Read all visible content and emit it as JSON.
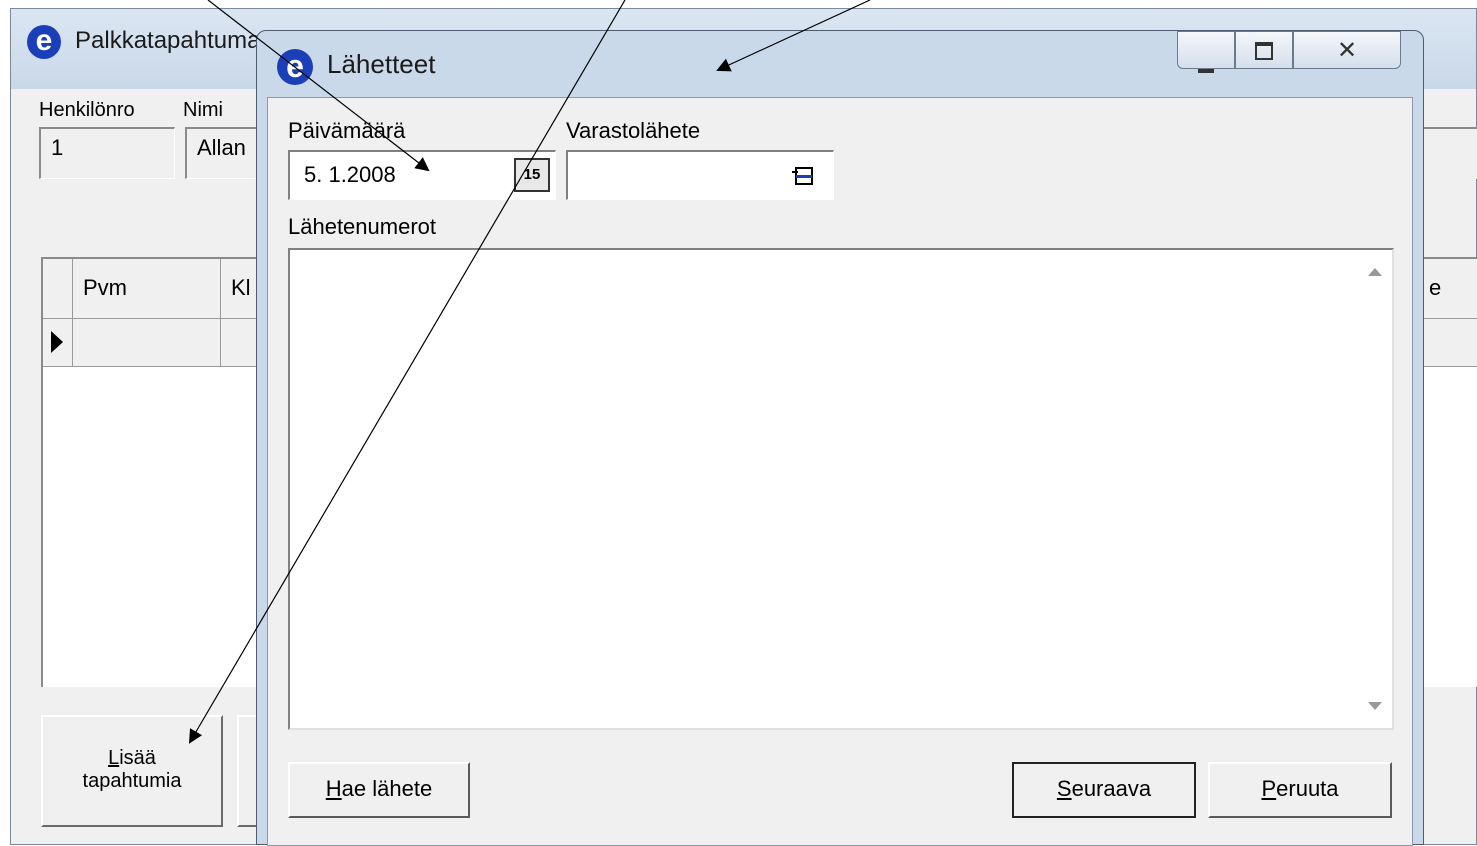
{
  "background_window": {
    "title": "Palkkatapahtumat",
    "henkilonro_label": "Henkilönro",
    "nimi_label": "Nimi",
    "henkilonro_value": "1",
    "nimi_value": "Allan",
    "grid": {
      "columns": [
        "Pvm",
        "Kl",
        "e"
      ]
    },
    "add_button_label_line1": "Lisää",
    "add_button_label_line2": "tapahtumia",
    "add_button_mnemonic": "L"
  },
  "dialog": {
    "title": "Lähetteet",
    "date_label": "Päivämäärä",
    "date_value": "5. 1.2008",
    "calendar_icon_text": "15",
    "warehouse_label": "Varastolähete",
    "warehouse_value": "",
    "numbers_label": "Lähetenumerot",
    "fetch_button": {
      "mnemonic": "H",
      "rest": "ae lähete"
    },
    "next_button": {
      "mnemonic": "S",
      "rest": "euraava"
    },
    "cancel_button": {
      "mnemonic": "P",
      "rest": "eruuta"
    }
  },
  "icons": {
    "app_logo": "e-logo-icon",
    "minimize": "minimize-icon",
    "maximize": "maximize-icon",
    "close": "close-icon",
    "calendar": "calendar-icon",
    "lookup": "lookup-icon",
    "row_pointer": "row-pointer-icon"
  },
  "colors": {
    "logo_blue": "#1a3fb8",
    "titlebar": "#c9d9ea",
    "dialog_bg": "#f0f0f0"
  }
}
